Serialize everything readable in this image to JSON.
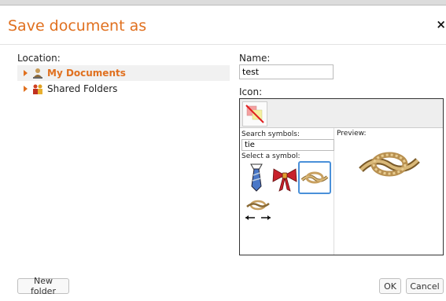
{
  "dialog": {
    "title": "Save document as",
    "close_glyph": "×"
  },
  "location": {
    "label": "Location:",
    "items": [
      {
        "label": "My Documents",
        "icon": "user-folder-icon",
        "selected": true
      },
      {
        "label": "Shared Folders",
        "icon": "shared-folder-icon",
        "selected": false
      }
    ]
  },
  "name": {
    "label": "Name:",
    "value": "test"
  },
  "icon": {
    "label": "Icon:",
    "search_label": "Search symbols:",
    "search_value": "tie",
    "select_label": "Select a symbol:",
    "preview_label": "Preview:",
    "symbols": [
      "necktie-symbol",
      "ribbon-bow-symbol",
      "knot-symbol",
      "tie-knot-arrows-symbol"
    ],
    "selected_symbol": "knot-symbol"
  },
  "buttons": {
    "new_folder": "New folder",
    "ok": "OK",
    "cancel": "Cancel"
  },
  "colors": {
    "accent": "#e0701f",
    "selection": "#4a90d9"
  }
}
